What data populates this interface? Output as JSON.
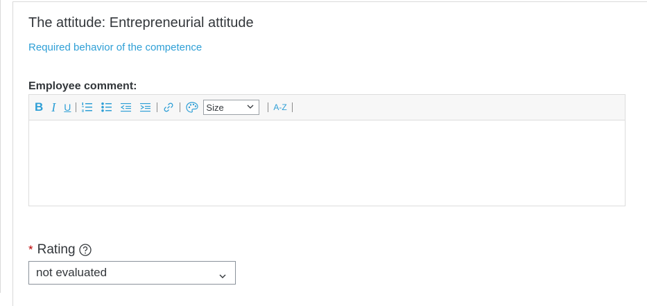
{
  "competence": {
    "title": "The attitude: Entrepreneurial attitude",
    "link_text": "Required behavior of the competence"
  },
  "comment": {
    "label": "Employee comment:",
    "toolbar": {
      "bold": "B",
      "italic": "I",
      "underline": "U",
      "size_value": "Size",
      "az": "A-Z"
    },
    "value": ""
  },
  "rating": {
    "required_marker": "*",
    "label": "Rating",
    "selected": "not evaluated"
  },
  "colors": {
    "accent": "#2e9fd6",
    "text": "#32363a",
    "required": "#bb0000",
    "border": "#dcdcdc"
  },
  "icons": [
    "ordered-list-icon",
    "bullet-list-icon",
    "outdent-icon",
    "indent-icon",
    "link-icon",
    "color-palette-icon",
    "chevron-down-icon",
    "help-icon"
  ]
}
